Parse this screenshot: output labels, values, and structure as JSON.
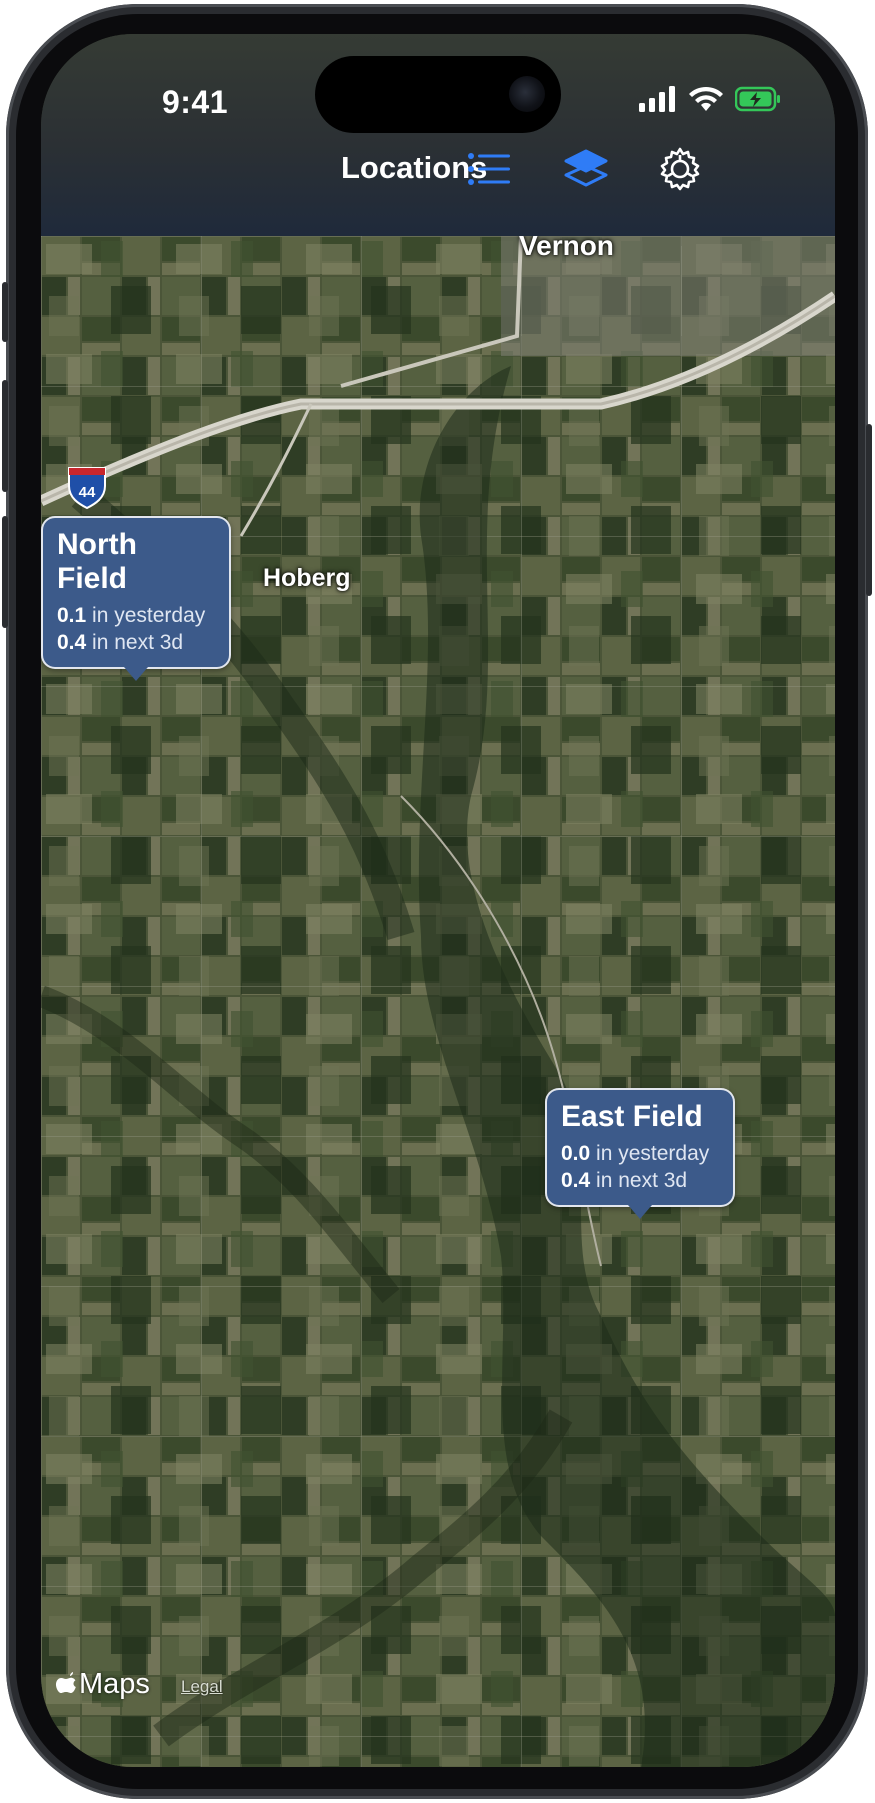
{
  "status_bar": {
    "time": "9:41",
    "signal_icon": "cellular-signal-icon",
    "wifi_icon": "wifi-icon",
    "battery_icon": "battery-charging-icon",
    "battery_color": "#34c759"
  },
  "nav": {
    "title": "Locations",
    "list_icon": "list-icon",
    "layers_icon": "layers-icon",
    "settings_icon": "gear-icon",
    "accent_color": "#2f7cf6"
  },
  "map": {
    "type": "satellite",
    "places": [
      "Vernon",
      "Hoberg"
    ],
    "highway_shield": "44",
    "callouts": [
      {
        "title": "North Field",
        "yesterday_value": "0.1",
        "yesterday_text": "in yesterday",
        "forecast_value": "0.4",
        "forecast_text": "in next 3d"
      },
      {
        "title": "East Field",
        "yesterday_value": "0.0",
        "yesterday_text": "in yesterday",
        "forecast_value": "0.4",
        "forecast_text": "in next 3d"
      }
    ],
    "attribution": "Maps",
    "legal": "Legal",
    "callout_color": "#3c5a8a"
  }
}
